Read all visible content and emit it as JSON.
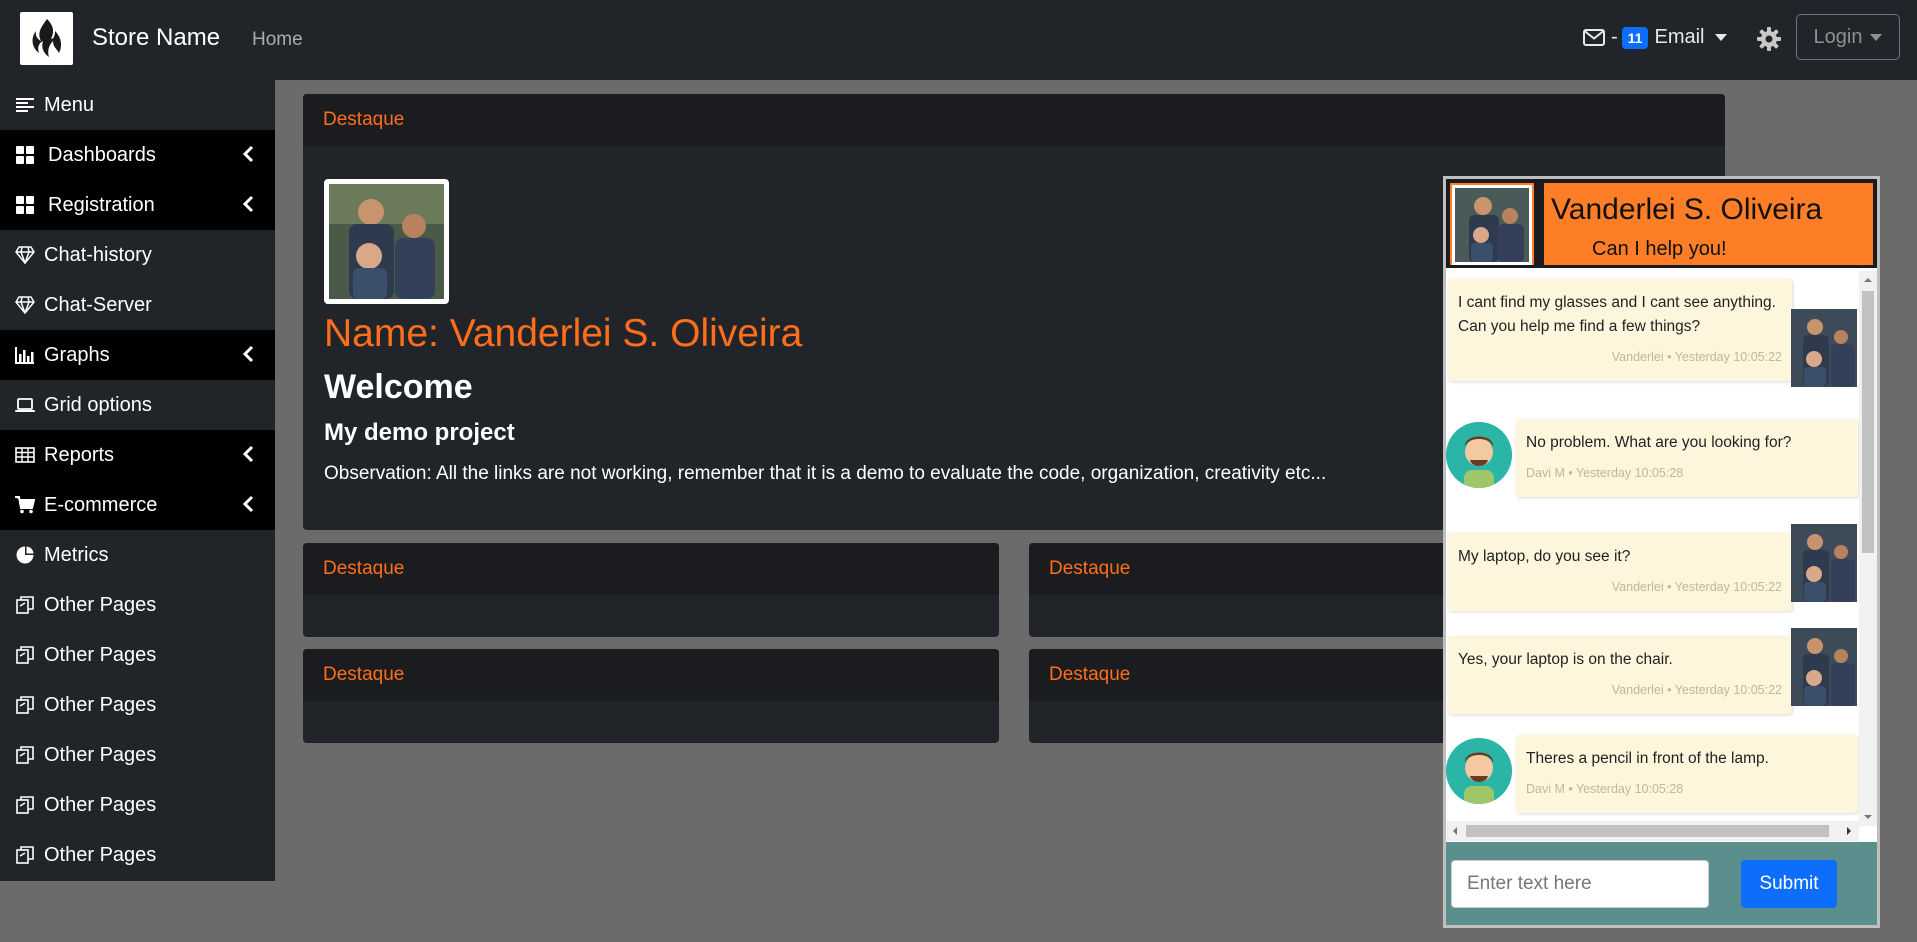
{
  "navbar": {
    "brand": "Store Name",
    "home": "Home",
    "email_prefix": "-",
    "email_count": "11",
    "email_label": "Email",
    "login_label": "Login"
  },
  "sidebar": {
    "items": [
      {
        "label": "Menu",
        "icon": "menu-lines-icon"
      },
      {
        "label": "Dashboards",
        "icon": "grid-icon"
      },
      {
        "label": "Registration",
        "icon": "grid-icon"
      },
      {
        "label": "Chat-history",
        "icon": "diamond-icon"
      },
      {
        "label": "Chat-Server",
        "icon": "diamond-icon"
      },
      {
        "label": "Graphs",
        "icon": "bar-chart-icon"
      },
      {
        "label": "Grid options",
        "icon": "laptop-icon"
      },
      {
        "label": "Reports",
        "icon": "table-icon"
      },
      {
        "label": "E-commerce",
        "icon": "cart-icon"
      },
      {
        "label": "Metrics",
        "icon": "pie-chart-icon"
      },
      {
        "label": "Other Pages",
        "icon": "pages-icon"
      },
      {
        "label": "Other Pages",
        "icon": "pages-icon"
      },
      {
        "label": "Other Pages",
        "icon": "pages-icon"
      },
      {
        "label": "Other Pages",
        "icon": "pages-icon"
      },
      {
        "label": "Other Pages",
        "icon": "pages-icon"
      },
      {
        "label": "Other Pages",
        "icon": "pages-icon"
      }
    ]
  },
  "main": {
    "card_title": "Destaque",
    "name_line": "Name: Vanderlei S. Oliveira",
    "welcome": "Welcome",
    "project": "My demo project",
    "observation": "Observation: All the links are not working, remember that it is a demo to evaluate the code, organization, creativity etc...",
    "small_cards": [
      "Destaque",
      "Destaque",
      "Destaque",
      "Destaque"
    ]
  },
  "chat": {
    "title": "Vanderlei S. Oliveira",
    "subtitle": "Can I help you!",
    "messages": [
      {
        "text": "I cant find my glasses and I cant see anything. Can you help me find a few things?",
        "meta": "Vanderlei • Yesterday 10:05:22",
        "side": "right"
      },
      {
        "text": "No problem. What are you looking for?",
        "meta": "Davi M • Yesterday 10:05:28",
        "side": "left"
      },
      {
        "text": "My laptop, do you see it?",
        "meta": "Vanderlei • Yesterday 10:05:22",
        "side": "right"
      },
      {
        "text": "Yes, your laptop is on the chair.",
        "meta": "Vanderlei • Yesterday 10:05:22",
        "side": "right"
      },
      {
        "text": "Theres a pencil in front of the lamp.",
        "meta": "Davi M • Yesterday 10:05:28",
        "side": "left"
      }
    ],
    "input_placeholder": "Enter text here",
    "submit_label": "Submit"
  },
  "colors": {
    "accent": "#ff6e1a",
    "navbar": "#212529",
    "chat_header": "#fe7e27",
    "chat_footer": "#5a8f8e",
    "message_bg": "#fdf5dc",
    "primary": "#0d6efd"
  }
}
